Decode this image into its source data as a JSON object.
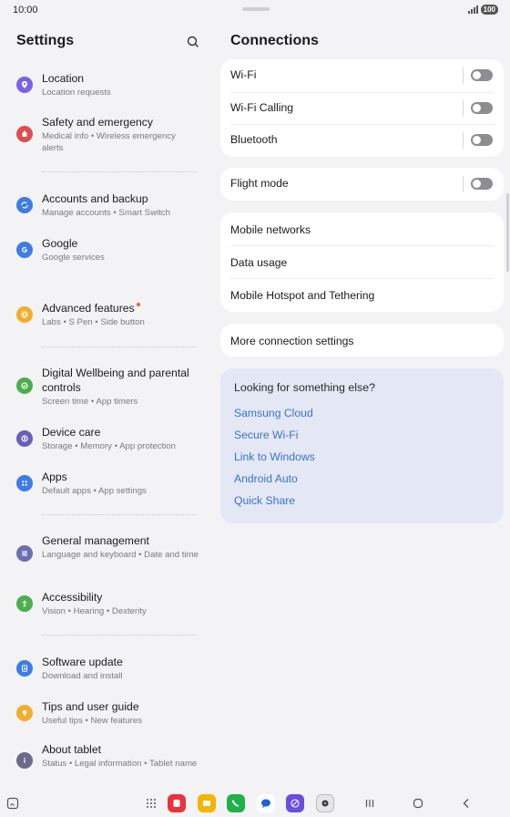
{
  "status_bar": {
    "time": "10:00",
    "battery": "100"
  },
  "left_pane": {
    "title": "Settings",
    "items": [
      {
        "label": "Location",
        "sub": "Location requests",
        "icon": "location-icon",
        "color": "#7b61e6"
      },
      {
        "label": "Safety and emergency",
        "sub": "Medical info  •  Wireless emergency alerts",
        "icon": "emergency-icon",
        "color": "#d94f4f"
      },
      {
        "label": "Accounts and backup",
        "sub": "Manage accounts  •  Smart Switch",
        "icon": "sync-icon",
        "color": "#3e7ce6"
      },
      {
        "label": "Google",
        "sub": "Google services",
        "icon": "google-icon",
        "color": "#3e7ce6"
      },
      {
        "label": "Advanced features",
        "sub": "Labs  •  S Pen  •  Side button",
        "icon": "advanced-features-icon",
        "color": "#f2ad2c"
      },
      {
        "label": "Digital Wellbeing and parental controls",
        "sub": "Screen time  •  App timers",
        "icon": "wellbeing-icon",
        "color": "#4cae4c"
      },
      {
        "label": "Device care",
        "sub": "Storage  •  Memory  •  App protection",
        "icon": "device-care-icon",
        "color": "#6a5fb5"
      },
      {
        "label": "Apps",
        "sub": "Default apps  •  App settings",
        "icon": "apps-icon",
        "color": "#3e7ce6"
      },
      {
        "label": "General management",
        "sub": "Language and keyboard  •  Date and time",
        "icon": "general-management-icon",
        "color": "#6a6fb1"
      },
      {
        "label": "Accessibility",
        "sub": "Vision  •  Hearing  •  Dexterity",
        "icon": "accessibility-icon",
        "color": "#4cae4c"
      },
      {
        "label": "Software update",
        "sub": "Download and install",
        "icon": "software-update-icon",
        "color": "#3e7ce6"
      },
      {
        "label": "Tips and user guide",
        "sub": "Useful tips  •  New features",
        "icon": "tips-icon",
        "color": "#f2ad2c"
      },
      {
        "label": "About tablet",
        "sub": "Status  •  Legal information  •  Tablet name",
        "icon": "info-icon",
        "color": "#6a6a8a"
      }
    ]
  },
  "right_pane": {
    "title": "Connections",
    "group1": [
      {
        "label": "Wi-Fi"
      },
      {
        "label": "Wi-Fi Calling"
      },
      {
        "label": "Bluetooth"
      }
    ],
    "group2": [
      {
        "label": "Flight mode"
      }
    ],
    "group3": [
      {
        "label": "Mobile networks"
      },
      {
        "label": "Data usage"
      },
      {
        "label": "Mobile Hotspot and Tethering"
      }
    ],
    "group4": [
      {
        "label": "More connection settings"
      }
    ],
    "suggestions": {
      "title": "Looking for something else?",
      "links": [
        "Samsung Cloud",
        "Secure Wi-Fi",
        "Link to Windows",
        "Android Auto",
        "Quick Share"
      ]
    }
  },
  "navbar": {
    "apps": [
      "app-drawer-icon",
      "cam-app-icon",
      "notes-icon",
      "phone-icon",
      "messages-icon",
      "internet-icon",
      "camera-icon"
    ]
  },
  "colors": {
    "accent_link": "#3a73c9",
    "toggle_off": "#8d8d92",
    "suggest_bg": "#e4e8f4"
  }
}
